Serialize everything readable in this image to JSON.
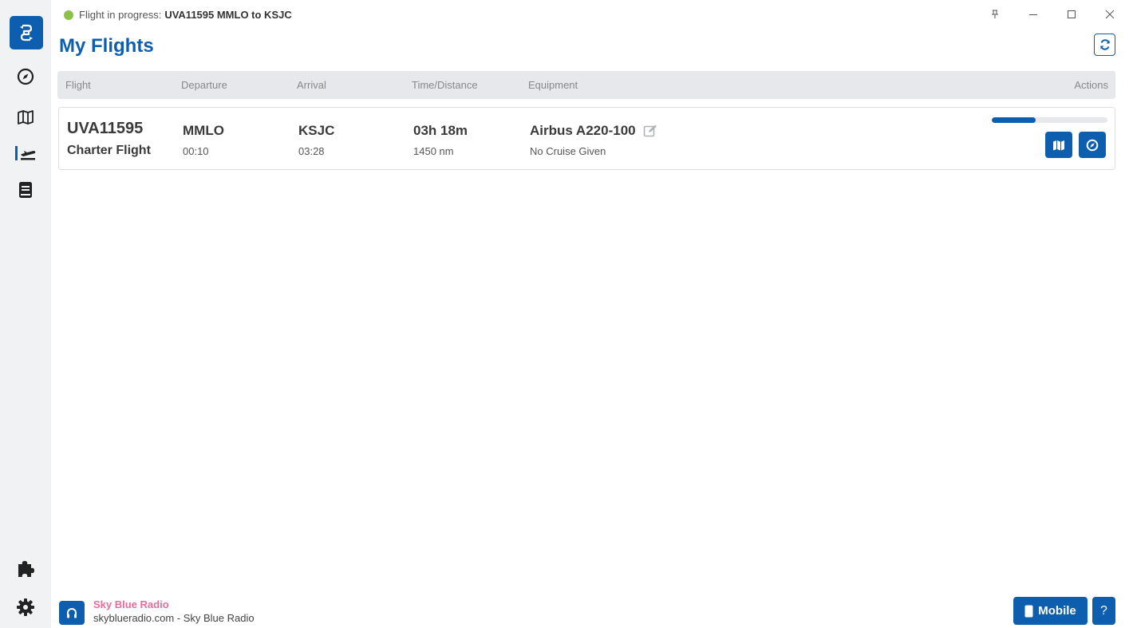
{
  "status": {
    "prefix": "Flight in progress:",
    "flight": "UVA11595 MMLO to KSJC",
    "dot_color": "#8cc04b"
  },
  "header": {
    "title": "My Flights"
  },
  "table": {
    "columns": [
      "Flight",
      "Departure",
      "Arrival",
      "Time/Distance",
      "Equipment",
      "Actions"
    ]
  },
  "flights": [
    {
      "number": "UVA11595",
      "type": "Charter Flight",
      "departure_code": "MMLO",
      "departure_time": "00:10",
      "arrival_code": "KSJC",
      "arrival_time": "03:28",
      "duration": "03h 18m",
      "distance": "1450 nm",
      "aircraft": "Airbus A220-100",
      "cruise": "No Cruise Given",
      "progress": 0.38
    }
  ],
  "sidebar": {
    "items": [
      "logo-icon",
      "compass-icon",
      "map-icon",
      "flights-icon",
      "logbook-icon",
      "plugins-icon",
      "settings-icon"
    ]
  },
  "footer": {
    "radio_name": "Sky Blue Radio",
    "radio_sub": "skyblueradio.com - Sky Blue Radio",
    "mobile_label": "Mobile",
    "help_label": "?"
  },
  "colors": {
    "accent": "#0d5eaf",
    "radio_pink": "#ec6b9c"
  }
}
